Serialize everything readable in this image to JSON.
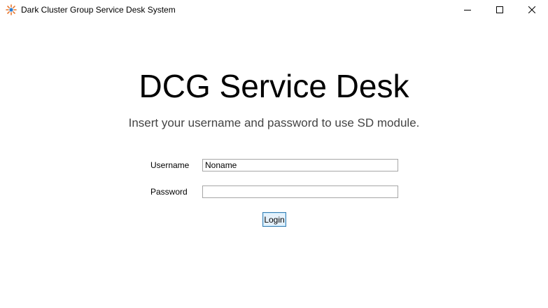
{
  "window": {
    "title": "Dark Cluster Group Service Desk System",
    "icon": "sun-burst-icon",
    "controls": {
      "minimize": "minimize-icon",
      "maximize": "maximize-icon",
      "close": "close-icon"
    }
  },
  "main": {
    "heading": "DCG Service Desk",
    "subheading": "Insert your username and password to use SD module."
  },
  "form": {
    "username_label": "Username",
    "username_value": "Noname",
    "password_label": "Password",
    "password_value": "",
    "login_label": "Login"
  },
  "colors": {
    "icon_rays": "#e8772e",
    "icon_center": "#2a7fd4",
    "button_border": "#3c7fb1",
    "button_fill": "#e5f1fb"
  }
}
